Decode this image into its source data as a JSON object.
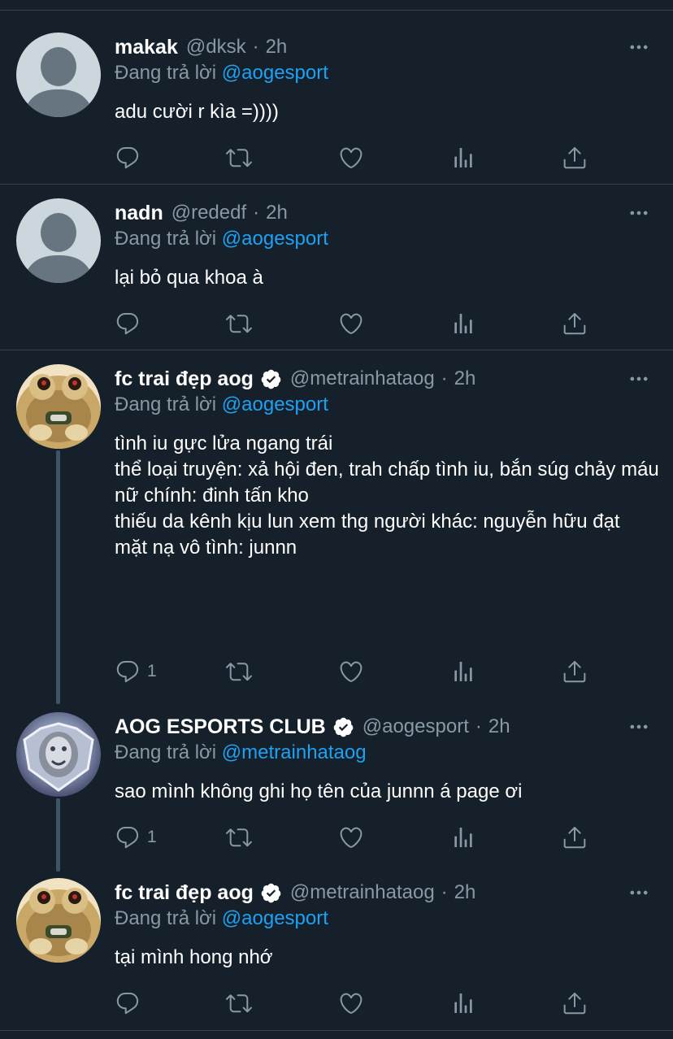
{
  "tweets": [
    {
      "name": "makak",
      "handle": "@dksk",
      "dot": "·",
      "time": "2h",
      "replying_prefix": "Đang trả lời",
      "replying_to": "@aogesport",
      "text": "adu cười r kìa =))))",
      "reply_count": "",
      "verified": false,
      "avatar": "default-avatar"
    },
    {
      "name": "nadn",
      "handle": "@rededf",
      "dot": "·",
      "time": "2h",
      "replying_prefix": "Đang trả lời",
      "replying_to": "@aogesport",
      "text": "lại bỏ qua khoa à",
      "reply_count": "",
      "verified": false,
      "avatar": "default-avatar"
    },
    {
      "name": "fc trai đẹp aog",
      "handle": "@metrainhataog",
      "dot": "·",
      "time": "2h",
      "replying_prefix": "Đang trả lời",
      "replying_to": "@aogesport",
      "text": "tình iu gực lửa ngang trái\nthể loại truyện: xả hội đen, trah chấp tình iu, bắn súg chảy máu\nnữ chính: đinh tấn kho\nthiếu da kênh kịu lun xem thg người khác: nguyễn hữu đạt\nmặt nạ vô tình: junnn",
      "reply_count": "1",
      "verified": true,
      "avatar": "frog-avatar"
    },
    {
      "name": "AOG ESPORTS CLUB",
      "handle": "@aogesport",
      "dot": "·",
      "time": "2h",
      "replying_prefix": "Đang trả lời",
      "replying_to": "@metrainhataog",
      "text": "sao mình không ghi họ tên của junnn á page ơi",
      "reply_count": "1",
      "verified": true,
      "avatar": "lion-logo-avatar"
    },
    {
      "name": "fc trai đẹp aog",
      "handle": "@metrainhataog",
      "dot": "·",
      "time": "2h",
      "replying_prefix": "Đang trả lời",
      "replying_to": "@aogesport",
      "text": "tại mình hong nhớ",
      "reply_count": "",
      "verified": true,
      "avatar": "frog-avatar"
    }
  ],
  "icons": {
    "reply": "reply-icon",
    "retweet": "retweet-icon",
    "like": "heart-icon",
    "analytics": "analytics-icon",
    "share": "share-icon",
    "more": "more-icon",
    "verified": "verified-badge-icon"
  },
  "colors": {
    "background": "#15202b",
    "secondary_text": "#8899a6",
    "mention": "#1da1f2",
    "divider": "#38444d"
  }
}
